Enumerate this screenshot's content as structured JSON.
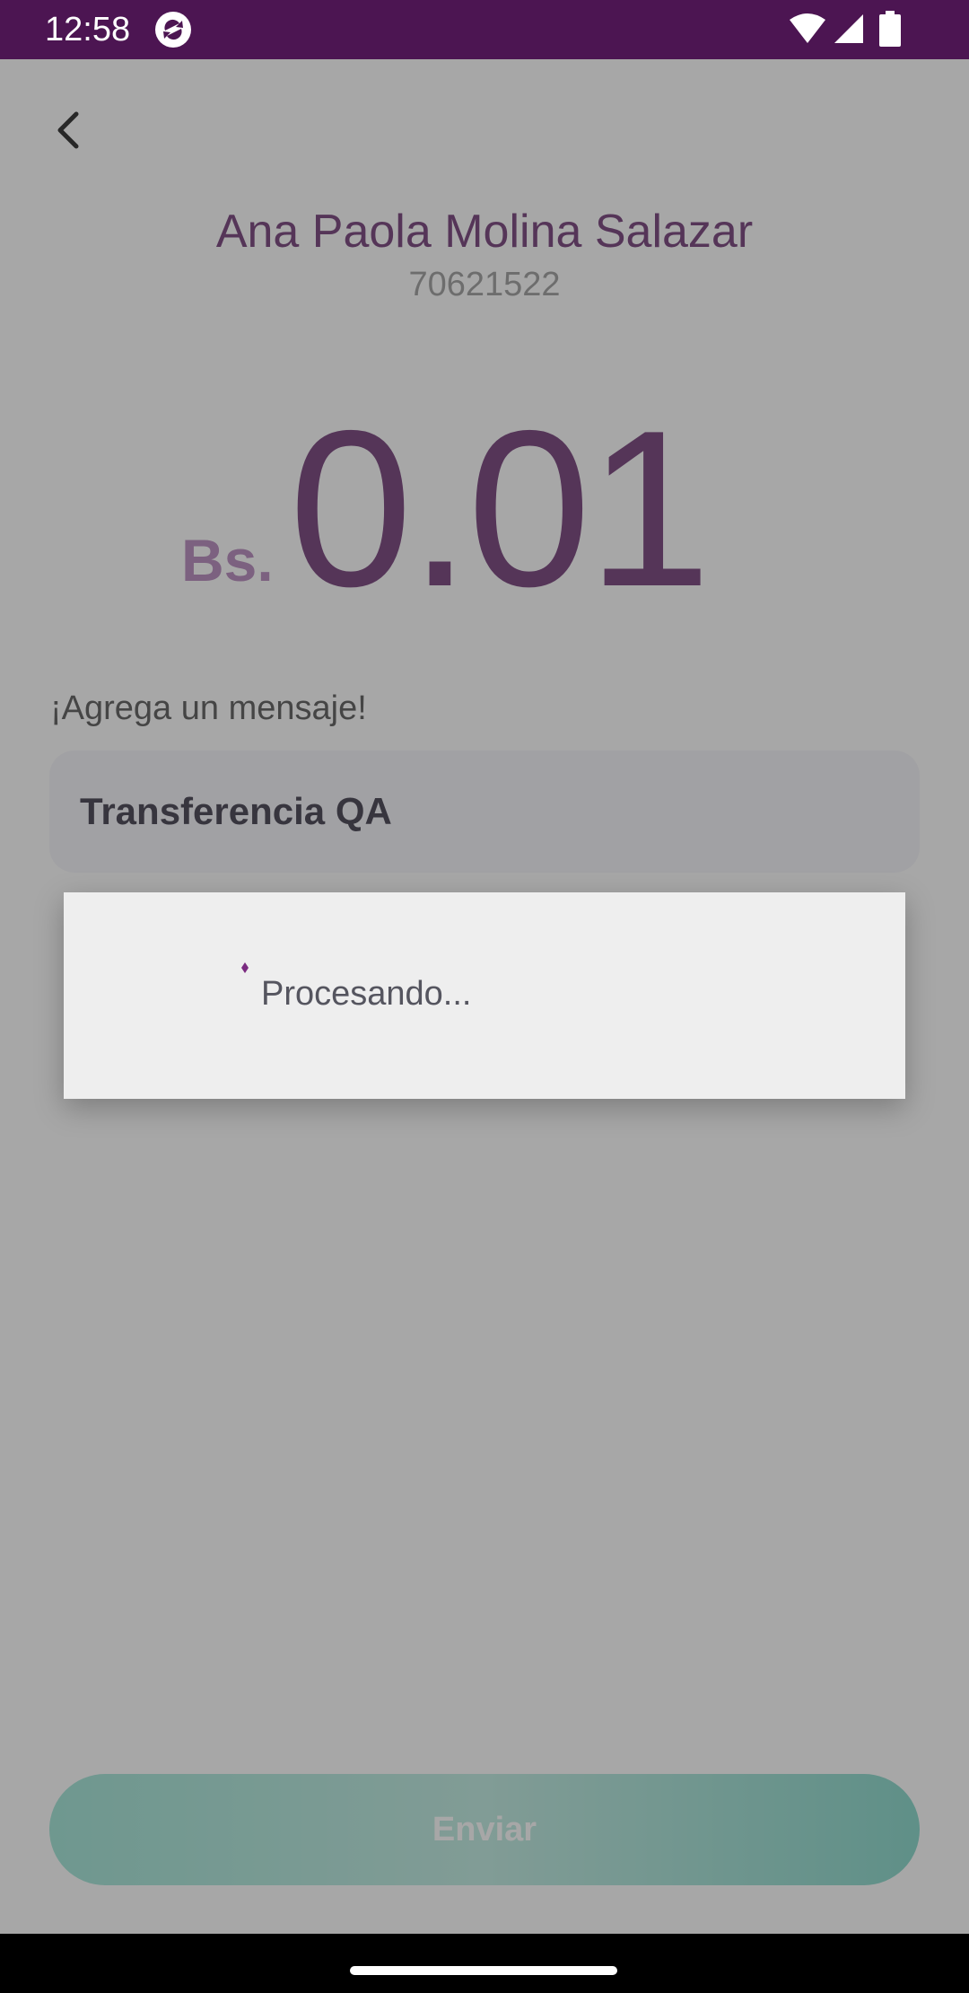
{
  "status_bar": {
    "time": "12:58"
  },
  "header": {
    "back_icon": "chevron-left-icon"
  },
  "recipient": {
    "name": "Ana Paola Molina Salazar",
    "phone": "70621522"
  },
  "amount": {
    "currency": "Bs.",
    "value": "0.01"
  },
  "message": {
    "label": "¡Agrega un mensaje!",
    "value": "Transferencia QA"
  },
  "send_button": {
    "label": "Enviar"
  },
  "dialog": {
    "text": "Procesando..."
  },
  "colors": {
    "brand_purple": "#5a1b61",
    "status_bar": "#4c1552",
    "currency_light": "#a973b0",
    "button_teal": "#8ee0cf"
  }
}
